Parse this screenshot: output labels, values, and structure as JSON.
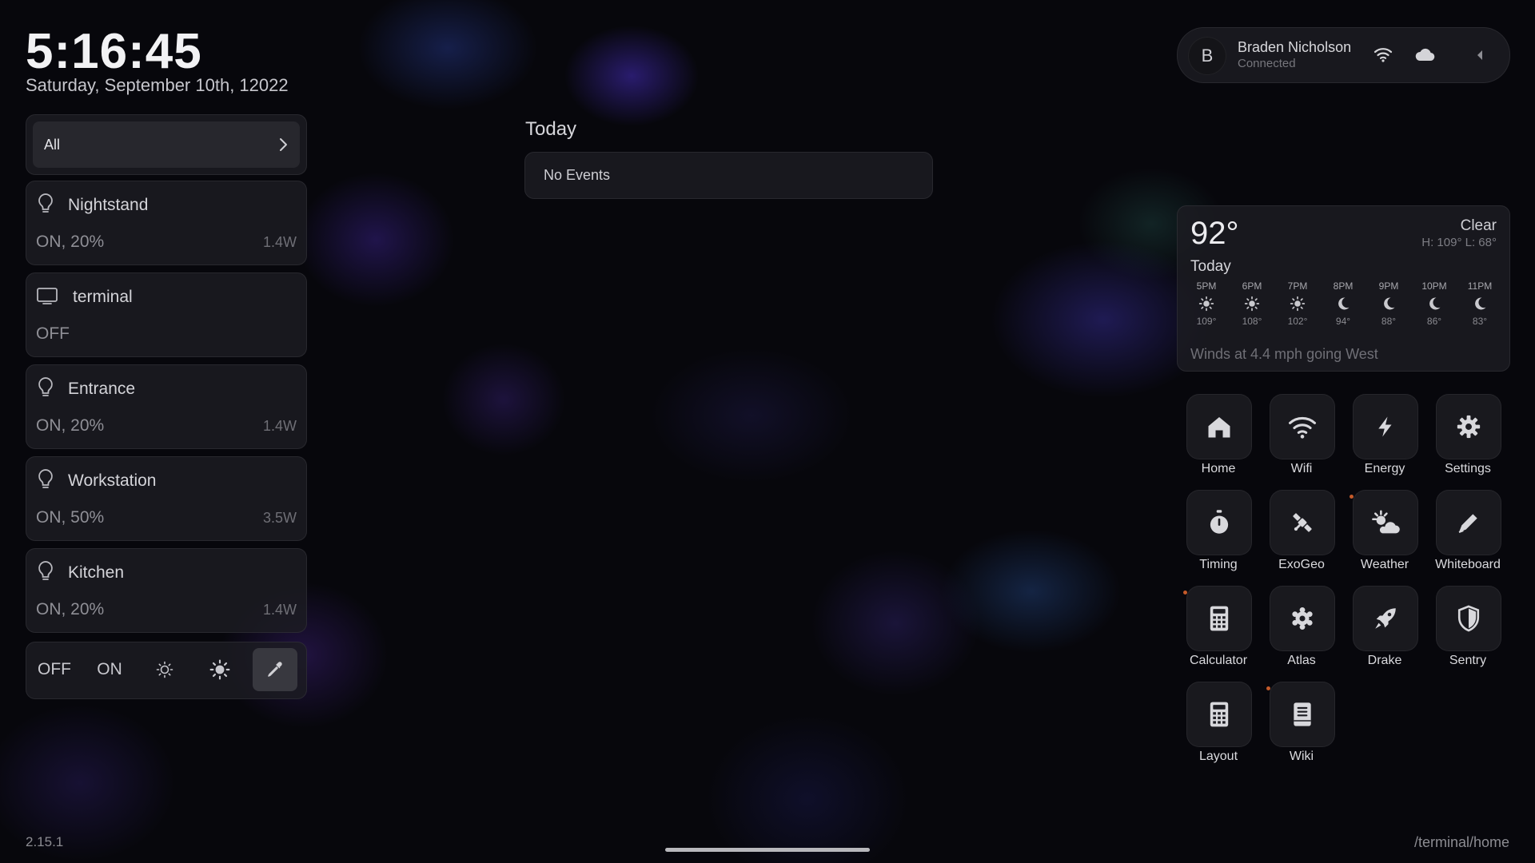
{
  "clock": {
    "time": "5:16:45",
    "date": "Saturday, September 10th, 12022"
  },
  "filter": {
    "label": "All"
  },
  "devices": [
    {
      "icon": "lightbulb-icon",
      "name": "Nightstand",
      "state": "ON, 20%",
      "watts": "1.4W"
    },
    {
      "icon": "monitor-icon",
      "name": "terminal",
      "state": "OFF",
      "watts": ""
    },
    {
      "icon": "lightbulb-icon",
      "name": "Entrance",
      "state": "ON, 20%",
      "watts": "1.4W"
    },
    {
      "icon": "lightbulb-icon",
      "name": "Workstation",
      "state": "ON, 50%",
      "watts": "3.5W"
    },
    {
      "icon": "lightbulb-icon",
      "name": "Kitchen",
      "state": "ON, 20%",
      "watts": "1.4W"
    }
  ],
  "controls": {
    "off": "OFF",
    "on": "ON"
  },
  "calendar": {
    "title": "Today",
    "empty": "No Events"
  },
  "profile": {
    "initial": "B",
    "name": "Braden Nicholson",
    "status": "Connected"
  },
  "weather": {
    "temp": "92°",
    "condition": "Clear",
    "hilo": "H: 109° L: 68°",
    "today": "Today",
    "hours": [
      {
        "time": "5PM",
        "icon": "sun-icon",
        "temp": "109°"
      },
      {
        "time": "6PM",
        "icon": "sun-icon",
        "temp": "108°"
      },
      {
        "time": "7PM",
        "icon": "sun-icon",
        "temp": "102°"
      },
      {
        "time": "8PM",
        "icon": "moon-icon",
        "temp": "94°"
      },
      {
        "time": "9PM",
        "icon": "moon-icon",
        "temp": "88°"
      },
      {
        "time": "10PM",
        "icon": "moon-icon",
        "temp": "86°"
      },
      {
        "time": "11PM",
        "icon": "moon-icon",
        "temp": "83°"
      }
    ],
    "wind": "Winds at 4.4 mph going West"
  },
  "apps": [
    {
      "label": "Home",
      "icon": "house-icon",
      "badge": false
    },
    {
      "label": "Wifi",
      "icon": "wifi-icon",
      "badge": false
    },
    {
      "label": "Energy",
      "icon": "bolt-icon",
      "badge": false
    },
    {
      "label": "Settings",
      "icon": "gear-icon",
      "badge": false
    },
    {
      "label": "Timing",
      "icon": "stopwatch-icon",
      "badge": false
    },
    {
      "label": "ExoGeo",
      "icon": "satellite-icon",
      "badge": false
    },
    {
      "label": "Weather",
      "icon": "sun-cloud-icon",
      "badge": true
    },
    {
      "label": "Whiteboard",
      "icon": "pen-icon",
      "badge": false
    },
    {
      "label": "Calculator",
      "icon": "calculator-icon",
      "badge": true
    },
    {
      "label": "Atlas",
      "icon": "atom-gear-icon",
      "badge": false
    },
    {
      "label": "Drake",
      "icon": "rocket-icon",
      "badge": false
    },
    {
      "label": "Sentry",
      "icon": "shield-icon",
      "badge": false
    },
    {
      "label": "Layout",
      "icon": "calculator-icon",
      "badge": false
    },
    {
      "label": "Wiki",
      "icon": "book-icon",
      "badge": true
    }
  ],
  "footer": {
    "version": "2.15.1",
    "path": "/terminal/home"
  },
  "colors": {
    "background": "#07070c",
    "panel": "#1c1c22",
    "badge": "#c45a2a"
  }
}
